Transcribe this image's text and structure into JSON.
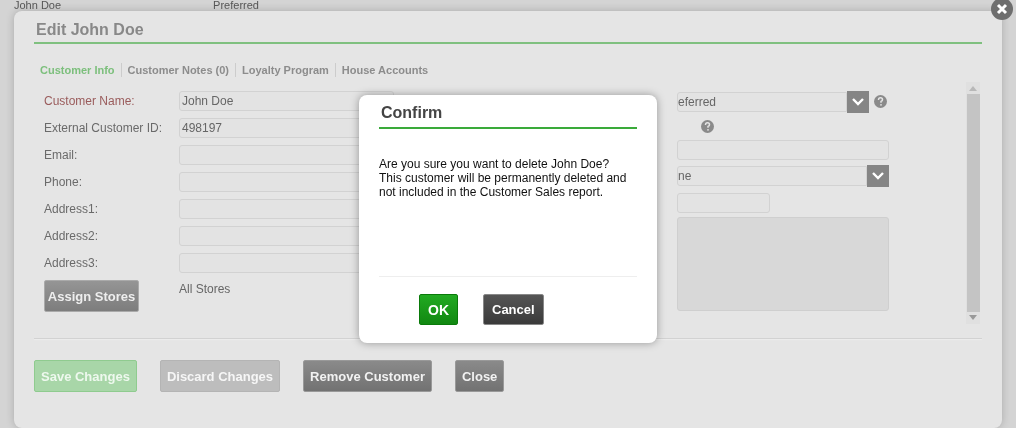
{
  "background_row": {
    "name": "John Doe",
    "tier": "Preferred"
  },
  "dialog": {
    "title": "Edit John Doe",
    "tabs": [
      {
        "label": "Customer Info",
        "selected": true
      },
      {
        "label": "Customer Notes (0)",
        "selected": false
      },
      {
        "label": "Loyalty Program",
        "selected": false
      },
      {
        "label": "House Accounts",
        "selected": false
      }
    ],
    "fields": [
      {
        "label": "Customer Name:",
        "value": "John Doe",
        "required": true
      },
      {
        "label": "External Customer ID:",
        "value": "498197",
        "required": false
      },
      {
        "label": "Email:",
        "required": false
      },
      {
        "label": "Phone:",
        "required": false
      },
      {
        "label": "Address1:",
        "required": false
      },
      {
        "label": "Address2:",
        "required": false
      },
      {
        "label": "Address3:",
        "required": false
      }
    ],
    "assign_stores_button": "Assign Stores",
    "stores": "All Stores",
    "right_fields": [
      {
        "kind": "select",
        "value": "eferred",
        "help": true
      },
      {
        "kind": "none",
        "help": true
      },
      {
        "kind": "input",
        "help": false
      },
      {
        "kind": "select",
        "value": "ne",
        "help": false
      },
      {
        "kind": "short-input",
        "help": false
      },
      {
        "kind": "textarea",
        "help": false
      }
    ],
    "buttons": [
      {
        "label": "Save Changes",
        "kind": "save",
        "disabled": true
      },
      {
        "label": "Discard Changes",
        "kind": "plain",
        "disabled": true
      },
      {
        "label": "Remove Customer",
        "kind": "plain",
        "disabled": false
      },
      {
        "label": "Close",
        "kind": "plain",
        "disabled": false
      }
    ]
  },
  "confirm": {
    "title": "Confirm",
    "message": "Are you sure you want to delete John Doe? This customer will be permanently deleted and not included in the Customer Sales report.",
    "buttons": [
      {
        "label": "OK",
        "kind": "primary"
      },
      {
        "label": "Cancel",
        "kind": "secondary"
      }
    ]
  }
}
